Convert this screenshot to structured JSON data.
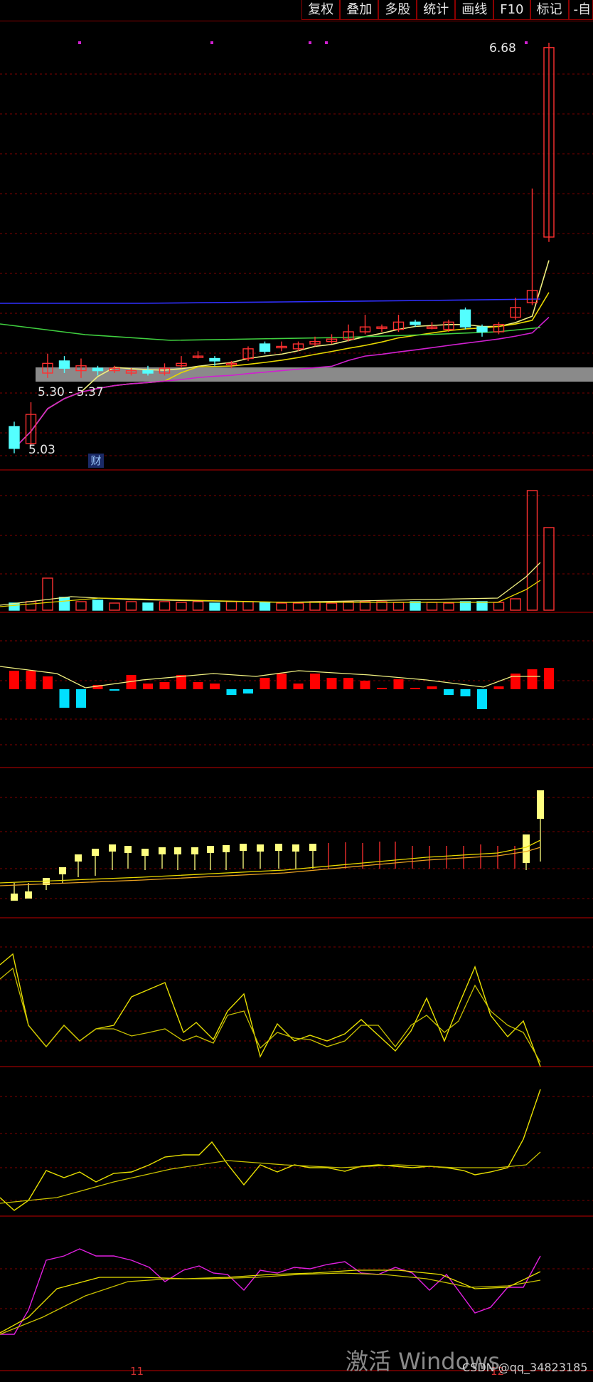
{
  "toolbar": {
    "buttons": [
      "复权",
      "叠加",
      "多股",
      "统计",
      "画线",
      "F10",
      "标记",
      "-自"
    ]
  },
  "price_labels": {
    "high_marker": "6.68",
    "range_band": "5.30 - 5.37",
    "low_marker": "5.03"
  },
  "badge": "财",
  "axis_ticks": {
    "first": "11",
    "second": "12"
  },
  "watermark": {
    "activate": "激活 Windows",
    "credit": "CSDN @qq_34823185"
  },
  "colors": {
    "up": "#ff3030",
    "down": "#54ffff",
    "ma_fast": "#f0f080",
    "ma_mid": "#e8d800",
    "ma_long": "#d020d0",
    "ma_green": "#40d040",
    "ma_blue": "#3030ff",
    "grid": "#800000",
    "volume_bar_up": "#ff3030",
    "macd_up": "#ff0000",
    "macd_down": "#00e0ff"
  },
  "chart_data": {
    "type": "candlestick",
    "candles": [
      {
        "o": 5.12,
        "c": 5.03,
        "h": 5.14,
        "l": 5.01
      },
      {
        "o": 5.05,
        "c": 5.17,
        "h": 5.22,
        "l": 5.04
      },
      {
        "o": 5.34,
        "c": 5.38,
        "h": 5.42,
        "l": 5.32
      },
      {
        "o": 5.39,
        "c": 5.36,
        "h": 5.41,
        "l": 5.34
      },
      {
        "o": 5.35,
        "c": 5.37,
        "h": 5.4,
        "l": 5.32
      },
      {
        "o": 5.36,
        "c": 5.35,
        "h": 5.37,
        "l": 5.33
      },
      {
        "o": 5.35,
        "c": 5.36,
        "h": 5.37,
        "l": 5.34
      },
      {
        "o": 5.34,
        "c": 5.35,
        "h": 5.36,
        "l": 5.33
      },
      {
        "o": 5.35,
        "c": 5.34,
        "h": 5.37,
        "l": 5.33
      },
      {
        "o": 5.34,
        "c": 5.36,
        "h": 5.38,
        "l": 5.33
      },
      {
        "o": 5.37,
        "c": 5.38,
        "h": 5.41,
        "l": 5.36
      },
      {
        "o": 5.41,
        "c": 5.41,
        "h": 5.43,
        "l": 5.4
      },
      {
        "o": 5.4,
        "c": 5.39,
        "h": 5.41,
        "l": 5.37
      },
      {
        "o": 5.38,
        "c": 5.38,
        "h": 5.39,
        "l": 5.36
      },
      {
        "o": 5.4,
        "c": 5.44,
        "h": 5.45,
        "l": 5.39
      },
      {
        "o": 5.46,
        "c": 5.43,
        "h": 5.47,
        "l": 5.42
      },
      {
        "o": 5.45,
        "c": 5.45,
        "h": 5.47,
        "l": 5.43
      },
      {
        "o": 5.44,
        "c": 5.46,
        "h": 5.47,
        "l": 5.43
      },
      {
        "o": 5.46,
        "c": 5.47,
        "h": 5.49,
        "l": 5.45
      },
      {
        "o": 5.47,
        "c": 5.48,
        "h": 5.5,
        "l": 5.46
      },
      {
        "o": 5.48,
        "c": 5.51,
        "h": 5.54,
        "l": 5.47
      },
      {
        "o": 5.51,
        "c": 5.53,
        "h": 5.58,
        "l": 5.5
      },
      {
        "o": 5.53,
        "c": 5.53,
        "h": 5.54,
        "l": 5.51
      },
      {
        "o": 5.52,
        "c": 5.55,
        "h": 5.58,
        "l": 5.51
      },
      {
        "o": 5.55,
        "c": 5.54,
        "h": 5.56,
        "l": 5.53
      },
      {
        "o": 5.53,
        "c": 5.53,
        "h": 5.55,
        "l": 5.52
      },
      {
        "o": 5.52,
        "c": 5.55,
        "h": 5.56,
        "l": 5.51
      },
      {
        "o": 5.6,
        "c": 5.53,
        "h": 5.61,
        "l": 5.52
      },
      {
        "o": 5.53,
        "c": 5.51,
        "h": 5.54,
        "l": 5.49
      },
      {
        "o": 5.51,
        "c": 5.54,
        "h": 5.55,
        "l": 5.5
      },
      {
        "o": 5.57,
        "c": 5.61,
        "h": 5.65,
        "l": 5.56
      },
      {
        "o": 5.63,
        "c": 5.68,
        "h": 6.1,
        "l": 5.62
      },
      {
        "o": 5.9,
        "c": 6.68,
        "h": 6.7,
        "l": 5.88
      }
    ]
  }
}
